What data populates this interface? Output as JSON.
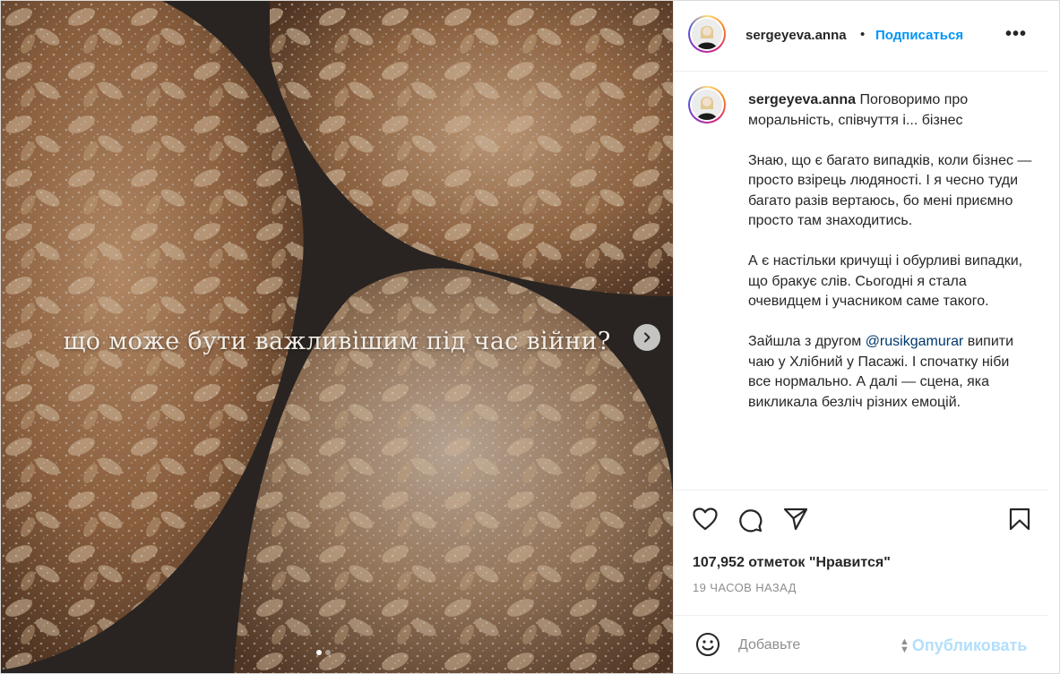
{
  "post": {
    "overlay_text": "що може бути важливішим під час війни?",
    "carousel_total": 2,
    "carousel_active": 1
  },
  "header": {
    "username": "sergeyeva.anna",
    "separator": "•",
    "follow_label": "Подписаться",
    "more_label": "•••"
  },
  "caption": {
    "username": "sergeyeva.anna",
    "first_line": "Поговоримо про моральність, співчуття і... бізнес",
    "paragraphs": [
      "Знаю, що є багато випадків, коли бізнес — просто взірець людяності. І я чесно туди багато разів вертаюсь, бо мені приємно просто там знаходитись.",
      "А є настільки кричущі і обурливі випадки, що бракує слів. Сьогодні я стала очевидцем і учасником саме такого."
    ],
    "p3_before": "Зайшла з другом ",
    "p3_mention": "@rusikgamurar",
    "p3_after": " випити чаю у Хлібний у Пасажі. І спочатку ніби все нормально. А далі — сцена, яка викликала безліч різних емоцій."
  },
  "actions": {
    "icons": [
      "heart-icon",
      "comment-icon",
      "share-icon",
      "bookmark-icon"
    ],
    "likes_text": "107,952 отметок \"Нравится\"",
    "time_text": "19 ЧАСОВ НАЗАД"
  },
  "comment": {
    "placeholder": "Добавьте",
    "publish_label": "Опубликовать",
    "emoji_icon": "emoji-icon"
  },
  "colors": {
    "accent": "#0095f6",
    "publish_disabled": "#b2dffc",
    "mention": "#00376b"
  }
}
